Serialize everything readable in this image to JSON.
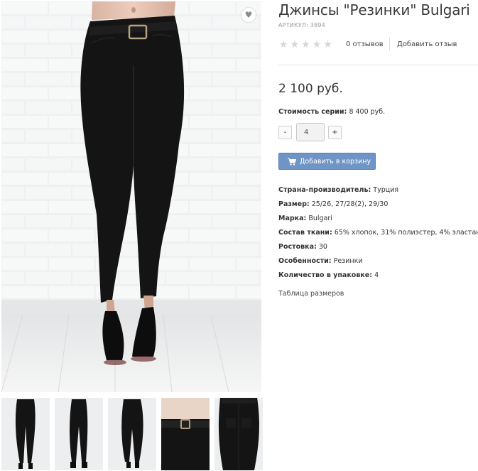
{
  "product": {
    "title": "Джинсы \"Резинки\" Bulgari",
    "sku": "АРТИКУЛ: 3894",
    "rating": 0,
    "reviews_count": "0 отзывов",
    "add_review": "Добавить отзыв",
    "price": "2 100 руб.",
    "series_label": "Стоимость серии:",
    "series_value": "8 400 руб.",
    "quantity": {
      "minus": "-",
      "value": "4",
      "plus": "+"
    },
    "add_to_cart": "Добавить в корзину",
    "specs": [
      {
        "label": "Страна-производитель:",
        "value": "Турция"
      },
      {
        "label": "Размер:",
        "value": "25/26, 27/28(2), 29/30"
      },
      {
        "label": "Марка:",
        "value": "Bulgari"
      },
      {
        "label": "Состав ткани:",
        "value": "65% хлопок, 31% полиэстер, 4% эластан"
      },
      {
        "label": "Ростовка:",
        "value": "30"
      },
      {
        "label": "Особенности:",
        "value": "Резинки"
      },
      {
        "label": "Количество в упаковке:",
        "value": "4"
      }
    ],
    "size_table_link": "Таблица размеров"
  },
  "gallery": {
    "wishlist_icon": "heart-icon",
    "thumbnail_count": 5
  },
  "icons": {
    "cart": "cart-icon",
    "star": "star-icon"
  },
  "colors": {
    "button": "#6f94c6",
    "star_empty": "#d6d6d6",
    "jeans": "#141414"
  }
}
